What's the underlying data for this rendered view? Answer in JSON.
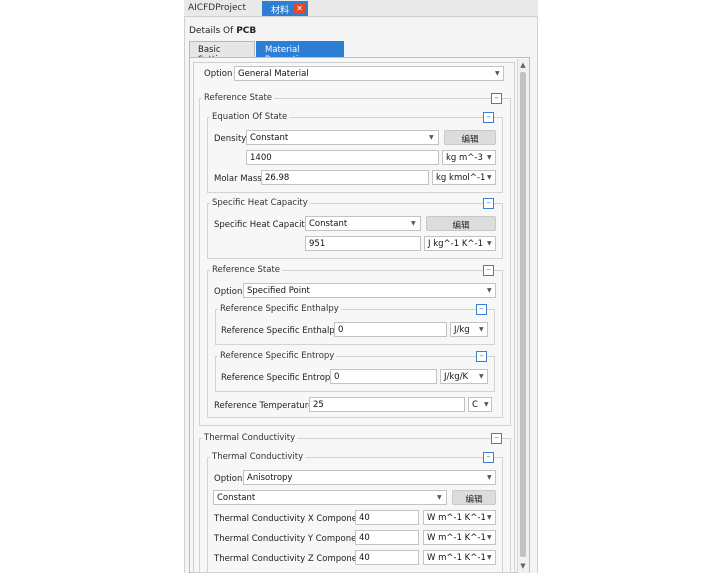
{
  "window": {
    "project_tab": "AICFDProject",
    "material_tab": "材料"
  },
  "details": {
    "prefix": "Details Of",
    "object": "PCB"
  },
  "tabs": {
    "basic": "Basic Setting",
    "material": "Material Properties"
  },
  "option": {
    "label": "Option",
    "value": "General Material"
  },
  "reference_state": {
    "title": "Reference State",
    "equation_of_state": {
      "title": "Equation Of State",
      "density_label": "Density",
      "density_mode": "Constant",
      "edit": "编辑",
      "density_value": "1400",
      "density_unit": "kg m^-3",
      "molar_label": "Molar Mass",
      "molar_value": "26.98",
      "molar_unit": "kg kmol^-1"
    },
    "specific_heat": {
      "title": "Specific Heat Capacity",
      "label": "Specific Heat Capacity",
      "mode": "Constant",
      "edit": "编辑",
      "value": "951",
      "unit": "J kg^-1 K^-1"
    },
    "ref_state": {
      "title": "Reference State",
      "option_label": "Option",
      "option_value": "Specified Point",
      "enthalpy": {
        "title": "Reference Specific Enthalpy",
        "label": "Reference Specific Enthalpy",
        "value": "0",
        "unit": "J/kg"
      },
      "entropy": {
        "title": "Reference Specific Entropy",
        "label": "Reference Specific Entropy",
        "value": "0",
        "unit": "J/kg/K"
      },
      "temperature": {
        "label": "Reference Temperature",
        "value": "25",
        "unit": "C"
      }
    }
  },
  "thermal": {
    "title": "Thermal Conductivity",
    "sub_title": "Thermal Conductivity",
    "option_label": "Option",
    "option_value": "Anisotropy",
    "mode": "Constant",
    "edit": "编辑",
    "x_label": "Thermal Conductivity X Component",
    "x_value": "40",
    "x_unit": "W m^-1 K^-1",
    "y_label": "Thermal Conductivity Y Component",
    "y_value": "40",
    "y_unit": "W m^-1 K^-1",
    "z_label": "Thermal Conductivity Z Component",
    "z_value": "40",
    "z_unit": "W m^-1 K^-1"
  },
  "icons": {
    "collapse": "collapse-icon",
    "close": "close-icon",
    "dropdown": "dropdown-arrow-icon"
  }
}
